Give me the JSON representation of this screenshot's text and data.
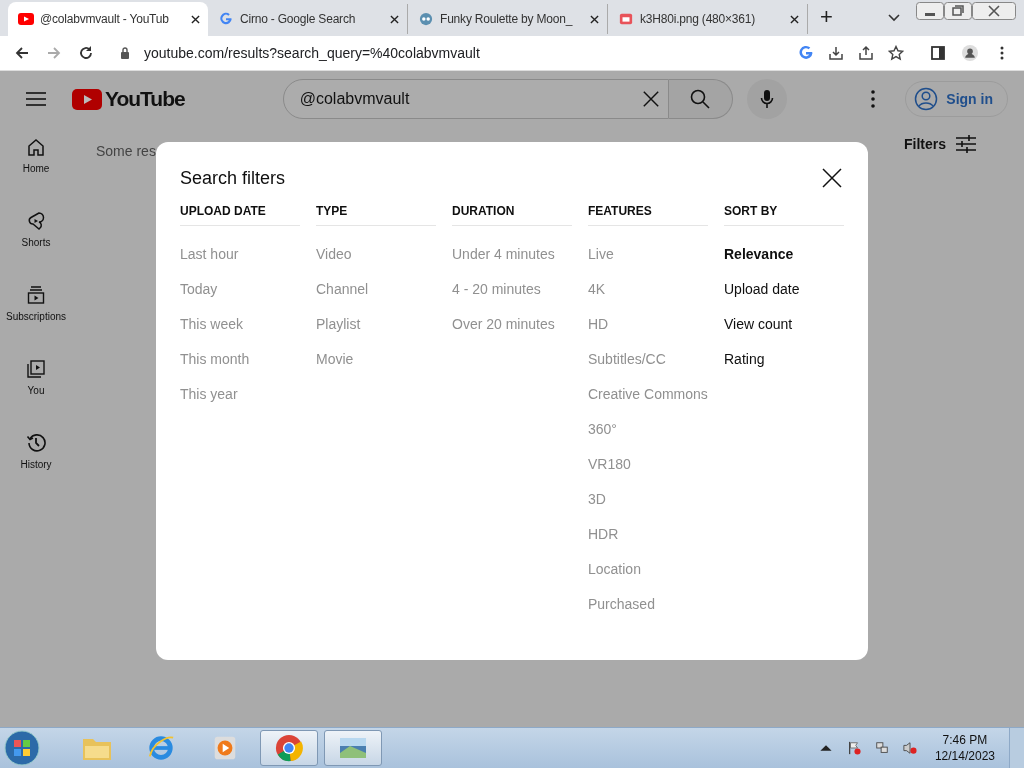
{
  "browser": {
    "tabs": [
      {
        "title": "@colabvmvault - YouTub",
        "kind": "youtube",
        "selected": true
      },
      {
        "title": "Cirno - Google Search",
        "kind": "google",
        "selected": false
      },
      {
        "title": "Funky Roulette by Moon_",
        "kind": "game",
        "selected": false
      },
      {
        "title": "k3H80i.png (480×361)",
        "kind": "image",
        "selected": false
      }
    ],
    "new_tab": "+",
    "address": "youtube.com/results?search_query=%40colabvmvault"
  },
  "youtube": {
    "logo": "YouTube",
    "search": {
      "value": "@colabvmvault"
    },
    "sign_in": "Sign in",
    "sidebar": [
      {
        "label": "Home",
        "kind": "home"
      },
      {
        "label": "Shorts",
        "kind": "shorts"
      },
      {
        "label": "Subscriptions",
        "kind": "subscriptions"
      },
      {
        "label": "You",
        "kind": "you"
      },
      {
        "label": "History",
        "kind": "history"
      }
    ],
    "results_note": "Some res",
    "filters_button": "Filters"
  },
  "dialog": {
    "title": "Search filters",
    "columns": [
      {
        "heading": "UPLOAD DATE",
        "options": [
          {
            "label": "Last hour",
            "selected": false,
            "disabled": true
          },
          {
            "label": "Today",
            "selected": false,
            "disabled": true
          },
          {
            "label": "This week",
            "selected": false,
            "disabled": true
          },
          {
            "label": "This month",
            "selected": false,
            "disabled": true
          },
          {
            "label": "This year",
            "selected": false,
            "disabled": true
          }
        ]
      },
      {
        "heading": "TYPE",
        "options": [
          {
            "label": "Video",
            "selected": false,
            "disabled": true
          },
          {
            "label": "Channel",
            "selected": false,
            "disabled": true
          },
          {
            "label": "Playlist",
            "selected": false,
            "disabled": true
          },
          {
            "label": "Movie",
            "selected": false,
            "disabled": true
          }
        ]
      },
      {
        "heading": "DURATION",
        "options": [
          {
            "label": "Under 4 minutes",
            "selected": false,
            "disabled": true
          },
          {
            "label": "4 - 20 minutes",
            "selected": false,
            "disabled": true
          },
          {
            "label": "Over 20 minutes",
            "selected": false,
            "disabled": true
          }
        ]
      },
      {
        "heading": "FEATURES",
        "options": [
          {
            "label": "Live",
            "selected": false,
            "disabled": true
          },
          {
            "label": "4K",
            "selected": false,
            "disabled": true
          },
          {
            "label": "HD",
            "selected": false,
            "disabled": true
          },
          {
            "label": "Subtitles/CC",
            "selected": false,
            "disabled": true
          },
          {
            "label": "Creative Commons",
            "selected": false,
            "disabled": true
          },
          {
            "label": "360°",
            "selected": false,
            "disabled": true
          },
          {
            "label": "VR180",
            "selected": false,
            "disabled": true
          },
          {
            "label": "3D",
            "selected": false,
            "disabled": true
          },
          {
            "label": "HDR",
            "selected": false,
            "disabled": true
          },
          {
            "label": "Location",
            "selected": false,
            "disabled": true
          },
          {
            "label": "Purchased",
            "selected": false,
            "disabled": true
          }
        ]
      },
      {
        "heading": "SORT BY",
        "options": [
          {
            "label": "Relevance",
            "selected": true,
            "disabled": false
          },
          {
            "label": "Upload date",
            "selected": false,
            "disabled": false
          },
          {
            "label": "View count",
            "selected": false,
            "disabled": false
          },
          {
            "label": "Rating",
            "selected": false,
            "disabled": false
          }
        ]
      }
    ]
  },
  "taskbar": {
    "apps": [
      {
        "kind": "folder",
        "selected": false
      },
      {
        "kind": "ie",
        "selected": false
      },
      {
        "kind": "media",
        "selected": false
      },
      {
        "kind": "chrome",
        "selected": true
      },
      {
        "kind": "photo",
        "selected": true
      }
    ],
    "time": "7:46 PM",
    "date": "12/14/2023"
  }
}
